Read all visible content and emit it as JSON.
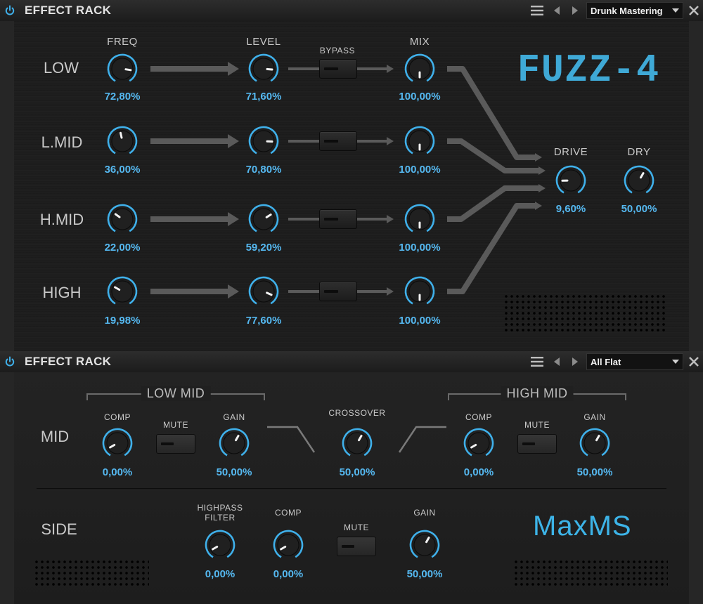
{
  "rack1": {
    "title": "EFFECT RACK",
    "preset": "Drunk Mastering",
    "logo": "FUZZ-4",
    "headers": {
      "freq": "FREQ",
      "level": "LEVEL",
      "bypass": "BYPASS",
      "mix": "MIX"
    },
    "bands": [
      {
        "name": "LOW",
        "freq": "72,80%",
        "level": "71,60%",
        "mix": "100,00%"
      },
      {
        "name": "L.MID",
        "freq": "36,00%",
        "level": "70,80%",
        "mix": "100,00%"
      },
      {
        "name": "H.MID",
        "freq": "22,00%",
        "level": "59,20%",
        "mix": "100,00%"
      },
      {
        "name": "HIGH",
        "freq": "19,98%",
        "level": "77,60%",
        "mix": "100,00%"
      }
    ],
    "drive": {
      "label": "DRIVE",
      "value": "9,60%"
    },
    "dry": {
      "label": "DRY",
      "value": "50,00%"
    }
  },
  "rack2": {
    "title": "EFFECT RACK",
    "preset": "All Flat",
    "logo": "MaxMS",
    "mid": {
      "label": "MID",
      "low_mid": {
        "title": "LOW MID",
        "comp_label": "COMP",
        "comp_value": "0,00%",
        "mute_label": "MUTE",
        "gain_label": "GAIN",
        "gain_value": "50,00%"
      },
      "crossover": {
        "label": "CROSSOVER",
        "value": "50,00%"
      },
      "high_mid": {
        "title": "HIGH MID",
        "comp_label": "COMP",
        "comp_value": "0,00%",
        "mute_label": "MUTE",
        "gain_label": "GAIN",
        "gain_value": "50,00%"
      }
    },
    "side": {
      "label": "SIDE",
      "hpf_label_line1": "HIGHPASS",
      "hpf_label_line2": "FILTER",
      "hpf_value": "0,00%",
      "comp_label": "COMP",
      "comp_value": "0,00%",
      "mute_label": "MUTE",
      "gain_label": "GAIN",
      "gain_value": "50,00%"
    }
  },
  "colors": {
    "accent": "#3fb0ea",
    "value_text": "#55b8f0",
    "background": "#1b1b1b"
  },
  "icons": [
    "power-icon",
    "menu-icon",
    "prev-arrow-icon",
    "next-arrow-icon",
    "dropdown-arrow-icon",
    "close-icon"
  ]
}
